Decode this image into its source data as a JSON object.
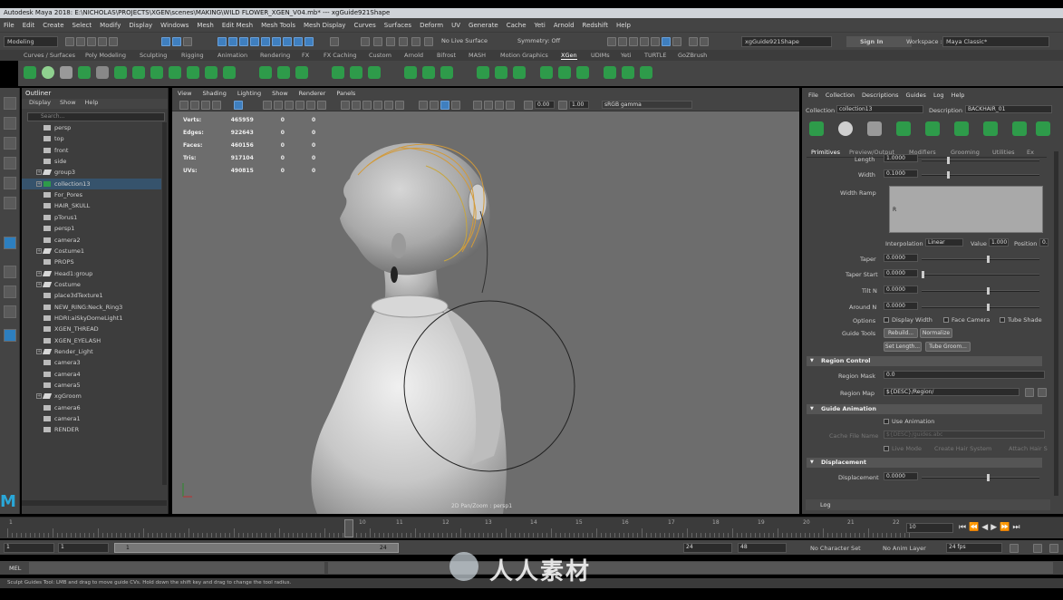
{
  "window": {
    "title": "Autodesk Maya 2018: E:\\NICHOLAS\\PROJECTS\\XGEN\\scenes\\MAKING\\WILD FLOWER_XGEN_V04.mb* --- xgGuide921Shape"
  },
  "menubar": {
    "items": [
      "File",
      "Edit",
      "Create",
      "Select",
      "Modify",
      "Display",
      "Windows",
      "Mesh",
      "Edit Mesh",
      "Mesh Tools",
      "Mesh Display",
      "Curves",
      "Surfaces",
      "Deform",
      "UV",
      "Generate",
      "Cache",
      "Yeti",
      "Arnold",
      "Redshift",
      "Help"
    ]
  },
  "status": {
    "mode": "Modeling",
    "live_surface": "No Live Surface",
    "symmetry": "Symmetry: Off",
    "object_field": "xgGuide921Shape",
    "sign_in": "Sign In",
    "workspace_label": "Workspace :",
    "workspace_value": "Maya Classic*"
  },
  "shelf": {
    "tabs": [
      "Curves / Surfaces",
      "Poly Modeling",
      "Sculpting",
      "Rigging",
      "Animation",
      "Rendering",
      "FX",
      "FX Caching",
      "Custom",
      "Arnold",
      "Bifrost",
      "MASH",
      "Motion Graphics",
      "XGen",
      "UDIMs",
      "Yeti",
      "TURTLE",
      "GoZBrush"
    ],
    "active": "XGen"
  },
  "outliner": {
    "title": "Outliner",
    "menu": [
      "Display",
      "Show",
      "Help"
    ],
    "search_placeholder": "Search...",
    "items": [
      {
        "label": "persp",
        "icon": "camera",
        "exp": ""
      },
      {
        "label": "top",
        "icon": "camera",
        "exp": ""
      },
      {
        "label": "front",
        "icon": "camera",
        "exp": ""
      },
      {
        "label": "side",
        "icon": "camera",
        "exp": ""
      },
      {
        "label": "group3",
        "icon": "group",
        "exp": "+"
      },
      {
        "label": "collection13",
        "icon": "collection",
        "exp": "+"
      },
      {
        "label": "For_Pores",
        "icon": "camera",
        "exp": ""
      },
      {
        "label": "HAIR_SKULL",
        "icon": "camera",
        "exp": ""
      },
      {
        "label": "pTorus1",
        "icon": "camera",
        "exp": ""
      },
      {
        "label": "persp1",
        "icon": "camera",
        "exp": ""
      },
      {
        "label": "camera2",
        "icon": "camera",
        "exp": ""
      },
      {
        "label": "Costume1",
        "icon": "group",
        "exp": "+"
      },
      {
        "label": "PROPS",
        "icon": "camera",
        "exp": ""
      },
      {
        "label": "Head1:group",
        "icon": "group",
        "exp": "+"
      },
      {
        "label": "Costume",
        "icon": "group",
        "exp": "+"
      },
      {
        "label": "place3dTexture1",
        "icon": "camera",
        "exp": ""
      },
      {
        "label": "NEW_RING:Neck_Ring3",
        "icon": "camera",
        "exp": ""
      },
      {
        "label": "HDRI:aiSkyDomeLight1",
        "icon": "camera",
        "exp": ""
      },
      {
        "label": "XGEN_THREAD",
        "icon": "camera",
        "exp": ""
      },
      {
        "label": "XGEN_EYELASH",
        "icon": "camera",
        "exp": ""
      },
      {
        "label": "Render_Light",
        "icon": "group",
        "exp": "+"
      },
      {
        "label": "camera3",
        "icon": "camera",
        "exp": ""
      },
      {
        "label": "camera4",
        "icon": "camera",
        "exp": ""
      },
      {
        "label": "camera5",
        "icon": "camera",
        "exp": ""
      },
      {
        "label": "xgGroom",
        "icon": "group",
        "exp": "+"
      },
      {
        "label": "camera6",
        "icon": "camera",
        "exp": ""
      },
      {
        "label": "camera1",
        "icon": "camera",
        "exp": ""
      },
      {
        "label": "RENDER",
        "icon": "camera",
        "exp": ""
      }
    ],
    "selected_index": 5
  },
  "viewport": {
    "menu": [
      "View",
      "Shading",
      "Lighting",
      "Show",
      "Renderer",
      "Panels"
    ],
    "exposure": "0.00",
    "gamma": "1.00",
    "color_space": "sRGB gamma",
    "stats": [
      {
        "name": "Verts:",
        "a": "465959",
        "b": "0",
        "c": "0"
      },
      {
        "name": "Edges:",
        "a": "922643",
        "b": "0",
        "c": "0"
      },
      {
        "name": "Faces:",
        "a": "460156",
        "b": "0",
        "c": "0"
      },
      {
        "name": "Tris:",
        "a": "917104",
        "b": "0",
        "c": "0"
      },
      {
        "name": "UVs:",
        "a": "490815",
        "b": "0",
        "c": "0"
      }
    ],
    "camera_label": "2D Pan/Zoom : persp1"
  },
  "xgen": {
    "menu": [
      "File",
      "Collection",
      "Descriptions",
      "Guides",
      "Log",
      "Help"
    ],
    "collection_label": "Collection",
    "collection_value": "collection13",
    "description_label": "Description",
    "description_value": "BACKHAIR_01",
    "tabs": [
      "Primitives",
      "Preview/Output",
      "Modifiers",
      "Grooming",
      "Utilities",
      "Ex"
    ],
    "length_label": "Length",
    "length_value": "1.0000",
    "width_label": "Width",
    "width_value": "0.1000",
    "width_ramp_label": "Width Ramp",
    "ramp_marker": "R",
    "interp_label": "Interpolation",
    "interp_value": "Linear",
    "value_label": "Value",
    "value_value": "1.000",
    "position_label": "Position",
    "position_value": "0.",
    "taper_label": "Taper",
    "taper_value": "0.0000",
    "taper_start_label": "Taper Start",
    "taper_start_value": "0.0000",
    "tilt_label": "Tilt N",
    "tilt_value": "0.0000",
    "around_label": "Around N",
    "around_value": "0.0000",
    "options_label": "Options",
    "opt1": "Display Width",
    "opt2": "Face Camera",
    "opt3": "Tube Shade",
    "guide_tools_label": "Guide Tools",
    "rebuild": "Rebuild...",
    "normalize": "Normalize",
    "set_length": "Set Length...",
    "tube_groom": "Tube Groom...",
    "region_control": "Region Control",
    "region_mask_label": "Region Mask",
    "region_mask_value": "0.0",
    "region_map_label": "Region Map",
    "region_map_value": "${DESC}/Region/",
    "guide_animation": "Guide Animation",
    "use_animation": "Use Animation",
    "cache_file_label": "Cache File Name",
    "cache_file_value": "${DESC}/guides.abc",
    "live_mode": "Live Mode",
    "create_hair": "Create Hair System",
    "attach_hair": "Attach Hair S",
    "displacement": "Displacement",
    "displacement_label": "Displacement",
    "displacement_value": "0.0000",
    "log": "Log"
  },
  "timeline": {
    "ticks": [
      "1",
      "",
      "",
      "10",
      "",
      "",
      "",
      "",
      "",
      "",
      "",
      "",
      "",
      "",
      "",
      "",
      "",
      "",
      "",
      "",
      "",
      "",
      "",
      "",
      "",
      "",
      "",
      "",
      "",
      "",
      "",
      "",
      "",
      "",
      "",
      "",
      "",
      "",
      "",
      "",
      "",
      "",
      "",
      "",
      "",
      "",
      "",
      "",
      "",
      "",
      "",
      "",
      "",
      "",
      "",
      "",
      "",
      "",
      "",
      "",
      "",
      "",
      "",
      "",
      "",
      "",
      "",
      "",
      "",
      "",
      "",
      "",
      "",
      "",
      "",
      "",
      "",
      "",
      "",
      "",
      "",
      "",
      "",
      "",
      "",
      "",
      "",
      "",
      "",
      "",
      "",
      "",
      "",
      ""
    ],
    "labels": [
      {
        "t": "1",
        "p": 0
      },
      {
        "t": "10",
        "p": 386
      },
      {
        "t": "11",
        "p": 427
      },
      {
        "t": "12",
        "p": 478
      },
      {
        "t": "13",
        "p": 525
      },
      {
        "t": "14",
        "p": 575
      },
      {
        "t": "15",
        "p": 625
      },
      {
        "t": "16",
        "p": 676
      },
      {
        "t": "17",
        "p": 727
      },
      {
        "t": "18",
        "p": 776
      },
      {
        "t": "19",
        "p": 826
      },
      {
        "t": "20",
        "p": 876
      },
      {
        "t": "21",
        "p": 925
      },
      {
        "t": "22",
        "p": 975
      }
    ],
    "current": "10",
    "frame_field": "10"
  },
  "range": {
    "start": "1",
    "start2": "1",
    "slider_start": "1",
    "slider_end": "24",
    "end": "24",
    "end2": "48",
    "character": "No Character Set",
    "anim_layer": "No Anim Layer",
    "fps": "24 fps"
  },
  "mel": {
    "label": "MEL"
  },
  "help": {
    "text": "Sculpt Guides Tool: LMB and drag to move guide CVs. Hold down the shift key and drag to change the tool radius."
  },
  "watermark": {
    "text": "人人素材"
  }
}
